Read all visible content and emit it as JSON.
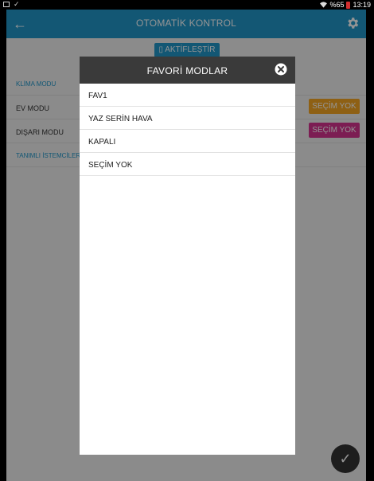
{
  "status_bar": {
    "battery_text": "%65",
    "time": "13:19"
  },
  "app_bar": {
    "title": "OTOMATİK KONTROL",
    "back_icon": "arrow-left-icon",
    "settings_icon": "gear-icon"
  },
  "activate_button": {
    "label": "AKTİFLEŞTİR"
  },
  "rows": [
    {
      "label": "KLİMA MODU"
    },
    {
      "label": "EV MODU",
      "selection": "SEÇİM YOK"
    },
    {
      "label": "DIŞARI MODU",
      "selection": "SEÇİM YOK"
    },
    {
      "label": "TANIMLI İSTEMCİLER"
    }
  ],
  "colors": {
    "primary": "#2196c9",
    "orange": "#f5a623",
    "pink": "#d6338f",
    "dialog_header": "#3a3a3a"
  },
  "dialog": {
    "title": "FAVORİ MODLAR",
    "close_icon": "close-circle-icon",
    "items": [
      {
        "label": "FAV1"
      },
      {
        "label": "YAZ SERİN HAVA"
      },
      {
        "label": "KAPALI"
      },
      {
        "label": "SEÇİM YOK"
      }
    ]
  },
  "fab": {
    "icon": "checkmark-icon"
  }
}
